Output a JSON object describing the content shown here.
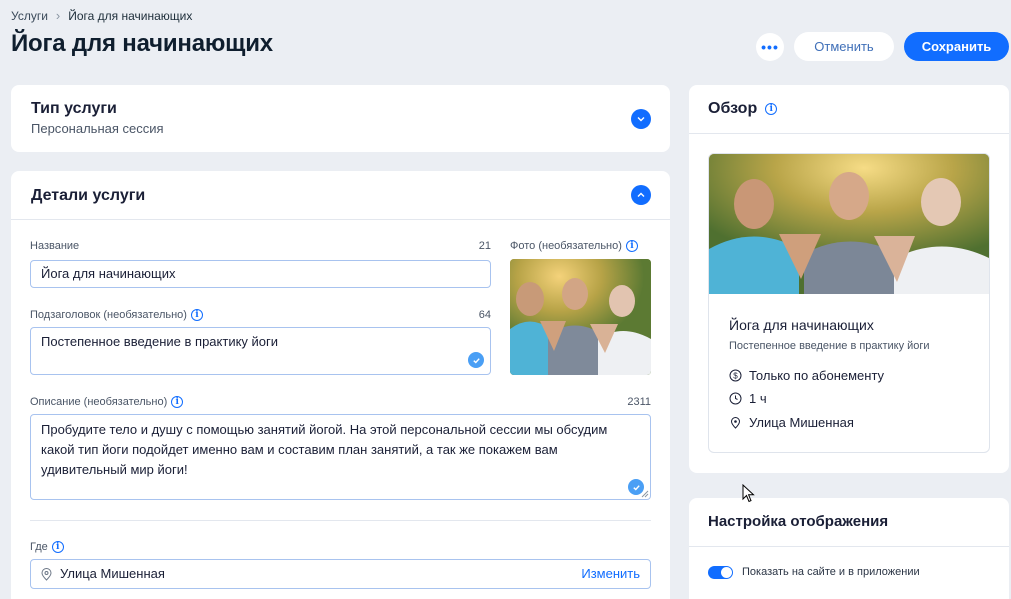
{
  "breadcrumb": {
    "root": "Услуги",
    "current": "Йога для начинающих"
  },
  "header": {
    "title": "Йога для начинающих",
    "more_label": "•••",
    "cancel_label": "Отменить",
    "save_label": "Сохранить"
  },
  "service_type": {
    "title": "Тип услуги",
    "value": "Персональная сессия"
  },
  "details": {
    "title": "Детали услуги",
    "name_label": "Название",
    "name_count": "21",
    "name_value": "Йога для начинающих",
    "photo_label": "Фото (необязательно)",
    "subtitle_label": "Подзаголовок (необязательно)",
    "subtitle_count": "64",
    "subtitle_value": "Постепенное введение в практику йоги",
    "description_label": "Описание (необязательно)",
    "description_count": "2311",
    "description_value": "Пробудите тело и душу с помощью занятий йогой. На этой персональной сессии мы обсудим какой тип йоги подойдет именно вам и составим план занятий, а так же покажем вам удивительный мир йоги!",
    "where_label": "Где",
    "where_value": "Улица Мишенная",
    "where_change": "Изменить"
  },
  "overview": {
    "title": "Обзор",
    "service_name": "Йога для начинающих",
    "service_subtitle": "Постепенное введение в практику йоги",
    "price": "Только по абонементу",
    "duration": "1 ч",
    "location": "Улица Мишенная"
  },
  "display_settings": {
    "title": "Настройка отображения",
    "toggle_label": "Показать на сайте и в приложении",
    "toggle_on": true
  },
  "colors": {
    "accent": "#116dff",
    "background": "#ebeef3"
  }
}
